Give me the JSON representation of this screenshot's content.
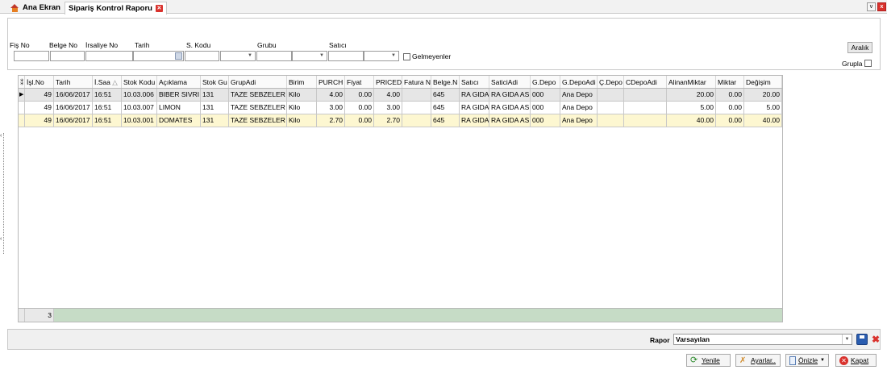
{
  "tabs": [
    {
      "label": "Ana Ekran"
    },
    {
      "label": "Sipariş Kontrol Raporu"
    }
  ],
  "window_buttons": {
    "dropdown": "v",
    "close": "x"
  },
  "filters": {
    "fis_no": "Fiş No",
    "belge_no": "Belge No",
    "irsaliye_no": "İrsaliye No",
    "tarih": "Tarih",
    "s_kodu": "S. Kodu",
    "grubu": "Grubu",
    "satici": "Satıcı",
    "gelmeyenler": "Gelmeyenler",
    "aralik": "Aralık",
    "grupla": "Grupla"
  },
  "grid": {
    "columns": [
      "İşl.No",
      "Tarih",
      "İ.Saa",
      "Stok Kodu",
      "Açıklama",
      "Stok Gu",
      "GrupAdi",
      "Birim",
      "PURCH",
      "Fiyat",
      "PRICED",
      "Fatura N",
      "Belge.N",
      "Satıcı",
      "SaticiAdi",
      "G.Depo",
      "G.DepoAdi",
      "Ç.Depo",
      "CDepoAdi",
      "AlinanMiktar",
      "Miktar",
      "Değişim"
    ],
    "rows": [
      [
        "49",
        "16/06/2017",
        "16:51",
        "10.03.006",
        "BIBER SIVRI",
        "131",
        "TAZE SEBZELER",
        "Kilo",
        "4.00",
        "0.00",
        "4.00",
        "",
        "645",
        "RA GIDA",
        "RA GIDA AS",
        "000",
        "Ana Depo",
        "",
        "",
        "20.00",
        "0.00",
        "20.00"
      ],
      [
        "49",
        "16/06/2017",
        "16:51",
        "10.03.007",
        "LIMON",
        "131",
        "TAZE SEBZELER",
        "Kilo",
        "3.00",
        "0.00",
        "3.00",
        "",
        "645",
        "RA GIDA",
        "RA GIDA AS",
        "000",
        "Ana Depo",
        "",
        "",
        "5.00",
        "0.00",
        "5.00"
      ],
      [
        "49",
        "16/06/2017",
        "16:51",
        "10.03.001",
        "DOMATES",
        "131",
        "TAZE SEBZELER",
        "Kilo",
        "2.70",
        "0.00",
        "2.70",
        "",
        "645",
        "RA GIDA",
        "RA GIDA AS",
        "000",
        "Ana Depo",
        "",
        "",
        "40.00",
        "0.00",
        "40.00"
      ]
    ],
    "record_count": "3"
  },
  "report": {
    "label": "Rapor",
    "value": "Varsayılan"
  },
  "buttons": {
    "yenile": "Yenile",
    "ayarlar": "Ayarlar..",
    "onizle": "Önizle",
    "kapat": "Kapat"
  },
  "colors": {
    "accent": "#d9322d",
    "selected_row": "#fdf7d1",
    "footer_green": "#c6dcc6",
    "highlight": "#e6e6e6"
  }
}
